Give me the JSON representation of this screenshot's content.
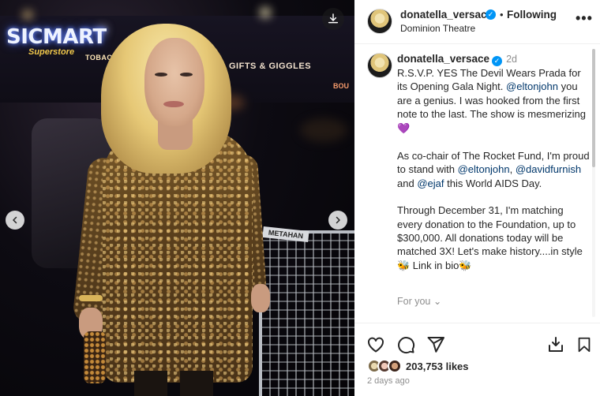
{
  "photo": {
    "sign_main": "SICMART",
    "sign_sub": "Superstore",
    "sign_tobacco": "TOBACCO • VAPE",
    "sign_gifts": "GIFTS & GIGGLES",
    "sign_boutique": "BOU",
    "barrier_plate": "METAHAN"
  },
  "header": {
    "username": "donatella_versace",
    "follow_separator": "•",
    "follow_label": "Following",
    "location": "Dominion Theatre",
    "more_icon": "more-horizontal-icon"
  },
  "caption": {
    "username": "donatella_versace",
    "time_ago": "2d",
    "p1_text1": "R.S.V.P. YES The Devil Wears Prada for its Opening Gala Night. ",
    "p1_mention": "@eltonjohn",
    "p1_text2": " you are a genius. I was hooked from the first note to the last. The show is mesmerizing ",
    "p1_emoji": "💜",
    "p2_text1": "As co-chair of The Rocket Fund, I'm proud to stand with ",
    "p2_mention1": "@eltonjohn",
    "p2_comma": ", ",
    "p2_mention2": "@davidfurnish",
    "p2_and": " and ",
    "p2_mention3": "@ejaf",
    "p2_text2": " this World AIDS Day.",
    "p3_text1": "Through December 31, I'm matching every donation to the Foundation, up to $300,000. All donations today will be matched 3X! Let's make history....in style ",
    "p3_emoji1": "🐝",
    "p3_text2": " Link in bio",
    "p3_emoji2": "🐝",
    "for_you": "For you ⌄"
  },
  "actions": {
    "like_icon": "heart-icon",
    "comment_icon": "comment-icon",
    "share_icon": "send-icon",
    "save_icon": "bookmark-icon"
  },
  "likes": {
    "count_text": "203,753 likes"
  },
  "post_date": "2 days ago"
}
